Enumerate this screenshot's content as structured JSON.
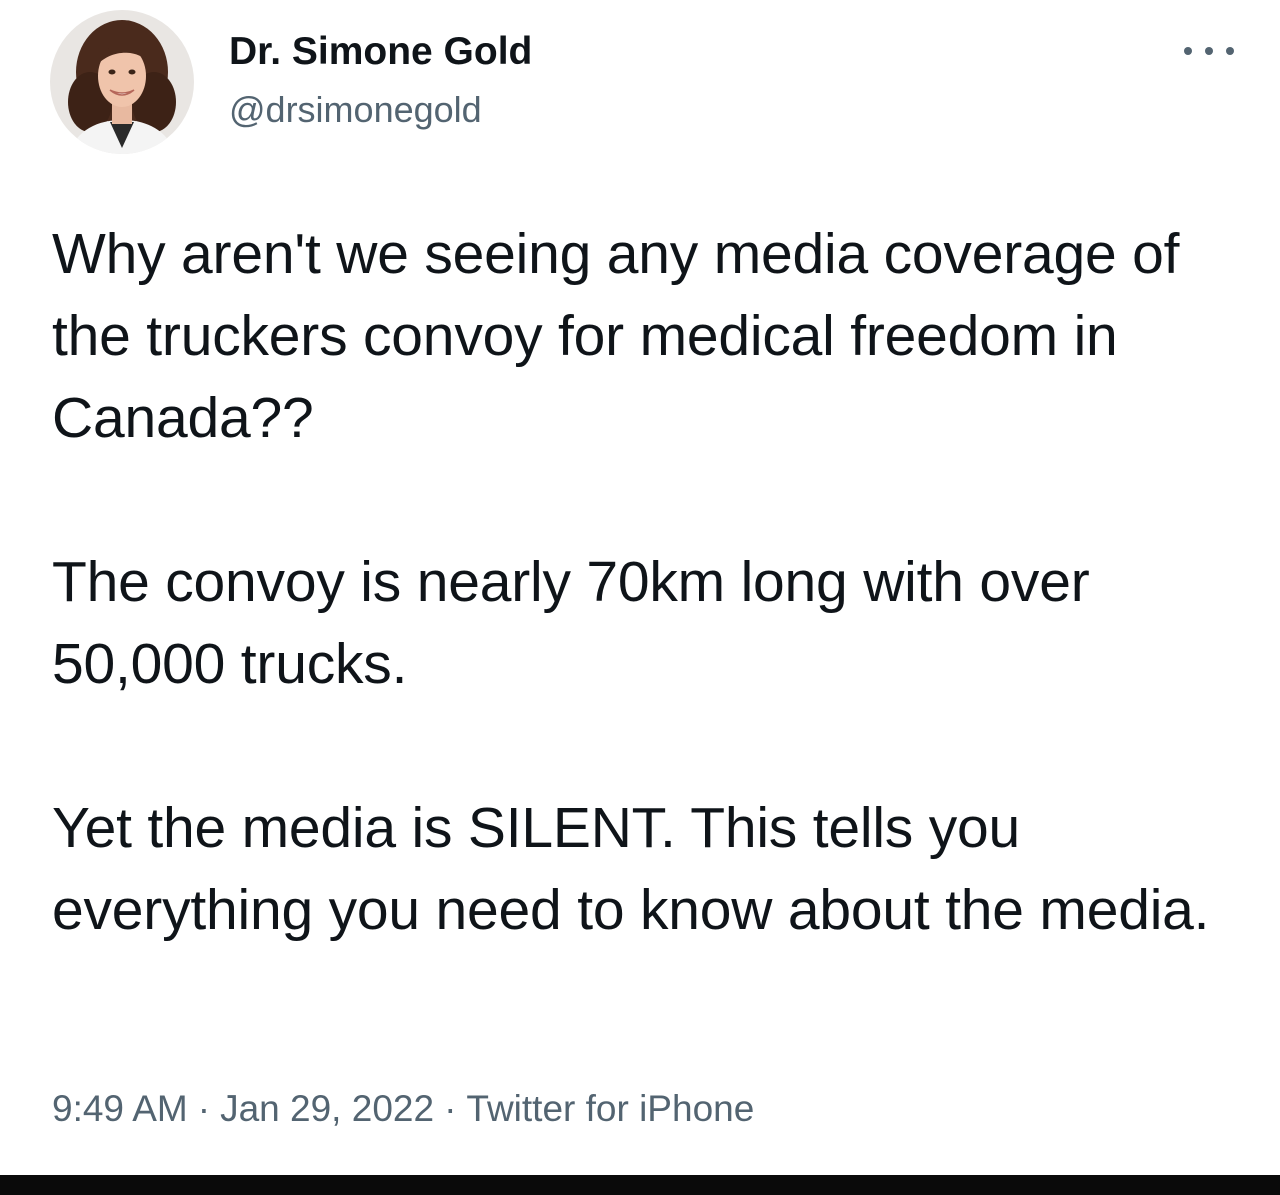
{
  "author": {
    "display_name": "Dr. Simone Gold",
    "handle": "@drsimonegold",
    "avatar_icon": "profile-photo"
  },
  "more_options_icon": "ellipsis-icon",
  "tweet": {
    "paragraphs": [
      "Why aren't we seeing any media coverage of the truckers convoy for medical freedom in Canada??",
      "The convoy is nearly 70km long with over 50,000 trucks.",
      "Yet the media is SILENT. This tells you everything you need to know about the media."
    ],
    "time": "9:49 AM",
    "separator": "·",
    "date": "Jan 29, 2022",
    "source": "Twitter for iPhone"
  },
  "colors": {
    "text_primary": "#0f1419",
    "text_secondary": "#536471",
    "background": "#ffffff"
  }
}
